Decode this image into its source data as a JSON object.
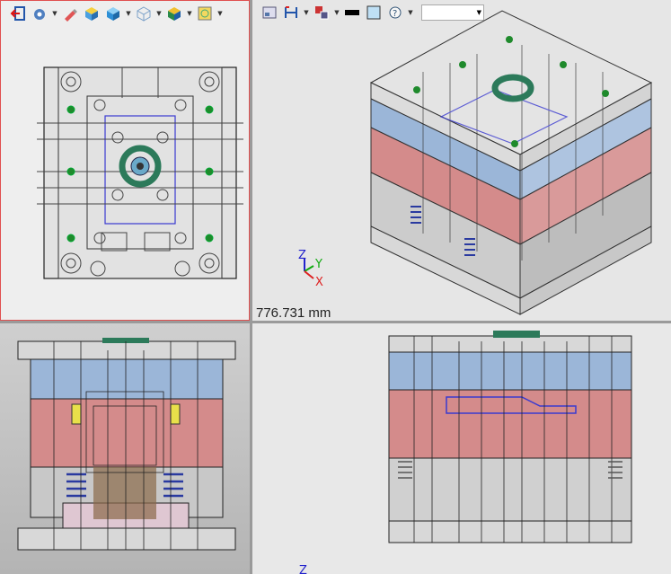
{
  "iso_view": {
    "measurement_readout": "776.731 mm",
    "triad_labels": {
      "x": "X",
      "y": "Y",
      "z": "Z"
    }
  },
  "side_view": {
    "triad_label_z": "Z"
  },
  "toolbar_left": {
    "icons": [
      "exit-icon",
      "settings-icon",
      "edit-tool-icon",
      "box-icon",
      "cube-shaded-icon",
      "cube-wireframe-icon",
      "cube-colored-icon",
      "display-frame-icon"
    ]
  },
  "toolbar_right": {
    "icons": [
      "view-icon",
      "dimension-icon",
      "layout-icon",
      "color-swatch-icon",
      "fill-icon",
      "info-icon"
    ],
    "dropdown_value": ""
  },
  "colors": {
    "plate_blue": "#9bb6d8",
    "plate_red": "#d48b8b",
    "plate_gray": "#cfcfcf",
    "viewport_active_border": "#e05050",
    "axis_x": "#d22",
    "axis_y": "#1a1",
    "axis_z": "#22c"
  }
}
